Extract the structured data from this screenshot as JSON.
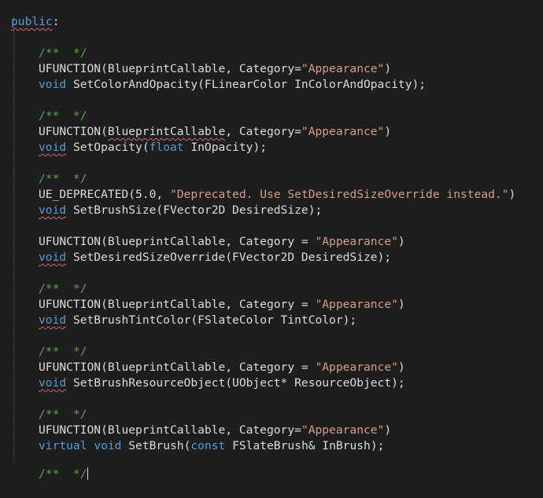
{
  "editor": {
    "access_specifier": "public",
    "colon": ":",
    "comment": "/**  */",
    "tokens": {
      "ufunction": "UFUNCTION",
      "blueprint_callable": "BlueprintCallable",
      "category_eq": ", Category=",
      "category_eq_spaced": ", Category = ",
      "appearance_str": "\"Appearance\"",
      "close_paren": ")",
      "open_paren": "(",
      "void": "void",
      "virtual": "virtual",
      "const": "const",
      "float": "float",
      "ue_deprecated": "UE_DEPRECATED",
      "deprecated_version": "5.0, ",
      "deprecated_msg": "\"Deprecated. Use SetDesiredSizeOverride instead.\"",
      "end_close": ");"
    },
    "functions": [
      {
        "name": "SetColorAndOpacity",
        "params": "FLinearColor InColorAndOpacity"
      },
      {
        "name": "SetOpacity",
        "params": " InOpacity"
      },
      {
        "name": "SetBrushSize",
        "params": "FVector2D DesiredSize"
      },
      {
        "name": "SetDesiredSizeOverride",
        "params": "FVector2D DesiredSize"
      },
      {
        "name": "SetBrushTintColor",
        "params": "FSlateColor TintColor"
      },
      {
        "name": "SetBrushResourceObject",
        "params": "UObject* ResourceObject"
      },
      {
        "name": "SetBrush",
        "params": " FSlateBrush& InBrush"
      }
    ],
    "last_comment_partial": "/**  */"
  }
}
